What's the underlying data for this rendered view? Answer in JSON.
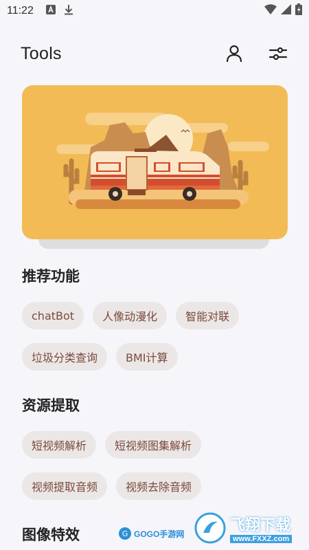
{
  "status_bar": {
    "time": "11:22"
  },
  "header": {
    "title": "Tools"
  },
  "icons": {
    "profile": "person-icon",
    "settings": "sliders-icon"
  },
  "sections": [
    {
      "title": "推荐功能",
      "chips": [
        "chatBot",
        "人像动漫化",
        "智能对联",
        "垃圾分类查询",
        "BMI计算"
      ]
    },
    {
      "title": "资源提取",
      "chips": [
        "短视频解析",
        "短视频图集解析",
        "视频提取音频",
        "视频去除音频"
      ]
    },
    {
      "title": "图像特效",
      "chips": []
    }
  ],
  "watermarks": {
    "site_cn": "飞翔下载",
    "site_url": "www.FXXZ.com",
    "gogo": "GOGO手游网"
  },
  "colors": {
    "background": "#f6f5f9",
    "banner": "#f2bb56",
    "chip_bg": "#ebe7e7",
    "chip_text": "#7a4a3a"
  }
}
